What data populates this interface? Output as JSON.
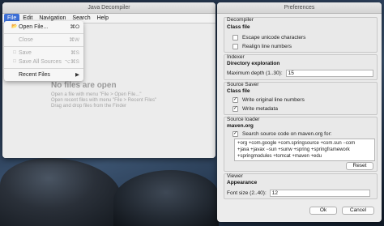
{
  "decompiler_window": {
    "title": "Java Decompiler",
    "menu": [
      "File",
      "Edit",
      "Navigation",
      "Search",
      "Help"
    ],
    "empty_state": {
      "title": "No files are open",
      "lines": [
        "Open a file with menu \"File > Open File...\"",
        "Open recent files with menu \"File > Recent Files\"",
        "Drag and drop files from the Finder"
      ]
    }
  },
  "file_menu": {
    "items": [
      {
        "label": "Open File...",
        "shortcut": "⌘O",
        "icon": "open-folder-icon",
        "enabled": true
      },
      {
        "label": "Close",
        "shortcut": "⌘W",
        "enabled": false
      },
      {
        "label": "Save",
        "shortcut": "⌘S",
        "icon": "save-icon",
        "enabled": false
      },
      {
        "label": "Save All Sources",
        "shortcut": "⌥⌘S",
        "icon": "save-all-icon",
        "enabled": false
      },
      {
        "label": "Recent Files",
        "submenu_arrow": "▶",
        "enabled": true
      }
    ]
  },
  "preferences": {
    "title": "Preferences",
    "decompiler": {
      "title": "Decompiler",
      "subtitle": "Class file",
      "escape_unicode": {
        "label": "Escape unicode characters",
        "checked": false
      },
      "realign": {
        "label": "Realign line numbers",
        "checked": false
      }
    },
    "indexer": {
      "title": "Indexer",
      "subtitle": "Directory exploration",
      "max_depth_label": "Maximum depth (1..30):",
      "max_depth_value": "15"
    },
    "source_saver": {
      "title": "Source Saver",
      "subtitle": "Class file",
      "write_original": {
        "label": "Write original line numbers",
        "checked": true
      },
      "write_metadata": {
        "label": "Write metadata",
        "checked": true
      }
    },
    "source_loader": {
      "title": "Source loader",
      "subtitle": "maven.org",
      "search_label": "Search source code on maven.org for:",
      "search_checked": true,
      "patterns": [
        "+org +com.google +com.springsource +com.sun −com",
        "+java +javax −sun +sunw +spring +springframework",
        "+springmodules +tomcat +maven +edu"
      ],
      "reset_label": "Reset"
    },
    "viewer": {
      "title": "Viewer",
      "subtitle": "Appearance",
      "font_size_label": "Font size (2..40):",
      "font_size_value": "12"
    },
    "ok_label": "Ok",
    "cancel_label": "Cancel"
  }
}
